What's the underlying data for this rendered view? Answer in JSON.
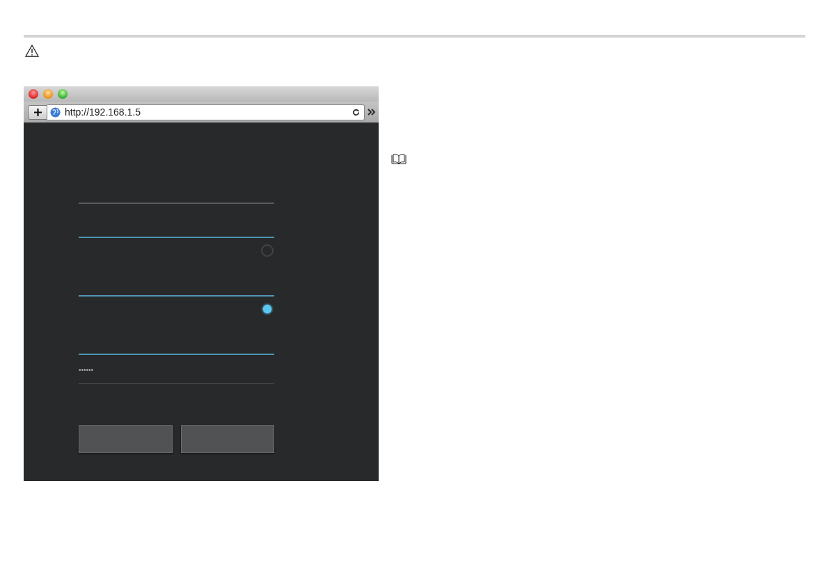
{
  "browser": {
    "url": "http://192.168.1.5"
  },
  "form": {
    "items": [
      {
        "kind": "field",
        "active": false
      },
      {
        "kind": "field",
        "active": true
      },
      {
        "kind": "radio",
        "selected": false
      },
      {
        "kind": "field",
        "active": true
      },
      {
        "kind": "radio",
        "selected": true
      },
      {
        "kind": "field",
        "active": true
      },
      {
        "kind": "password",
        "value": "••••••"
      }
    ],
    "buttons": [
      {
        "kind": "button"
      },
      {
        "kind": "button"
      }
    ]
  }
}
